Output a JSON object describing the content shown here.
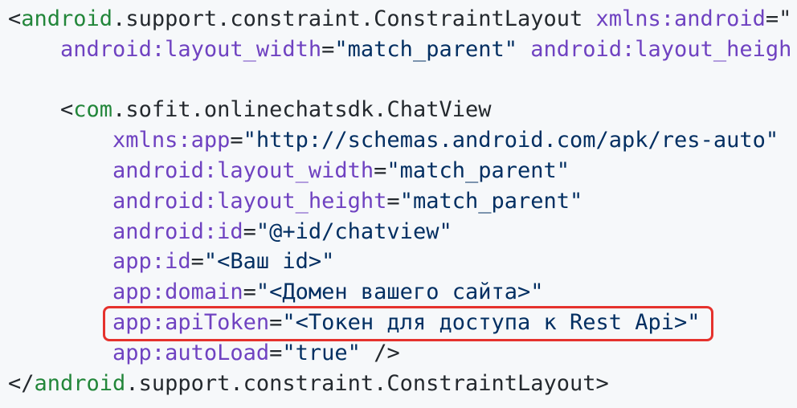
{
  "code_lines": [
    {
      "indent": "",
      "tokens": [
        {
          "text": "<",
          "kind": "punc"
        },
        {
          "text": "android",
          "kind": "tag"
        },
        {
          "text": ".support.constraint.ConstraintLayout ",
          "kind": "punc"
        },
        {
          "text": "xmlns:android",
          "kind": "attr"
        },
        {
          "text": "=\"",
          "kind": "punc"
        }
      ]
    },
    {
      "indent": "    ",
      "tokens": [
        {
          "text": "android:layout_width",
          "kind": "attr"
        },
        {
          "text": "=",
          "kind": "punc"
        },
        {
          "text": "\"match_parent\" ",
          "kind": "str"
        },
        {
          "text": "android:layout_heigh",
          "kind": "attr"
        }
      ]
    },
    {
      "indent": "",
      "tokens": []
    },
    {
      "indent": "    ",
      "tokens": [
        {
          "text": "<",
          "kind": "punc"
        },
        {
          "text": "com",
          "kind": "tag"
        },
        {
          "text": ".sofit.onlinechatsdk.ChatView",
          "kind": "punc"
        }
      ]
    },
    {
      "indent": "        ",
      "tokens": [
        {
          "text": "xmlns:app",
          "kind": "attr"
        },
        {
          "text": "=",
          "kind": "punc"
        },
        {
          "text": "\"http://schemas.android.com/apk/res-auto\"",
          "kind": "str"
        }
      ]
    },
    {
      "indent": "        ",
      "tokens": [
        {
          "text": "android:layout_width",
          "kind": "attr"
        },
        {
          "text": "=",
          "kind": "punc"
        },
        {
          "text": "\"match_parent\"",
          "kind": "str"
        }
      ]
    },
    {
      "indent": "        ",
      "tokens": [
        {
          "text": "android:layout_height",
          "kind": "attr"
        },
        {
          "text": "=",
          "kind": "punc"
        },
        {
          "text": "\"match_parent\"",
          "kind": "str"
        }
      ]
    },
    {
      "indent": "        ",
      "tokens": [
        {
          "text": "android:id",
          "kind": "attr"
        },
        {
          "text": "=",
          "kind": "punc"
        },
        {
          "text": "\"@+id/chatview\"",
          "kind": "str"
        }
      ]
    },
    {
      "indent": "        ",
      "tokens": [
        {
          "text": "app:id",
          "kind": "attr"
        },
        {
          "text": "=",
          "kind": "punc"
        },
        {
          "text": "\"<Ваш id>\"",
          "kind": "str"
        }
      ]
    },
    {
      "indent": "        ",
      "tokens": [
        {
          "text": "app:domain",
          "kind": "attr"
        },
        {
          "text": "=",
          "kind": "punc"
        },
        {
          "text": "\"<Домен вашего сайта>\"",
          "kind": "str"
        }
      ]
    },
    {
      "indent": "        ",
      "highlighted": true,
      "tokens": [
        {
          "text": "app:apiToken",
          "kind": "attr"
        },
        {
          "text": "=",
          "kind": "punc"
        },
        {
          "text": "\"<Токен для доступа к Rest Api>\"",
          "kind": "str"
        }
      ]
    },
    {
      "indent": "        ",
      "tokens": [
        {
          "text": "app:autoLoad",
          "kind": "attr"
        },
        {
          "text": "=",
          "kind": "punc"
        },
        {
          "text": "\"true\"",
          "kind": "str"
        },
        {
          "text": " />",
          "kind": "punc"
        }
      ]
    },
    {
      "indent": "",
      "tokens": [
        {
          "text": "</",
          "kind": "punc"
        },
        {
          "text": "android",
          "kind": "tag"
        },
        {
          "text": ".support.constraint.ConstraintLayout>",
          "kind": "punc"
        }
      ]
    }
  ],
  "colors": {
    "background": "#f6f8fa",
    "tag": "#22863a",
    "attribute": "#6f42c1",
    "string": "#032f62",
    "plain": "#24292e",
    "highlight_border": "#e5322d"
  }
}
